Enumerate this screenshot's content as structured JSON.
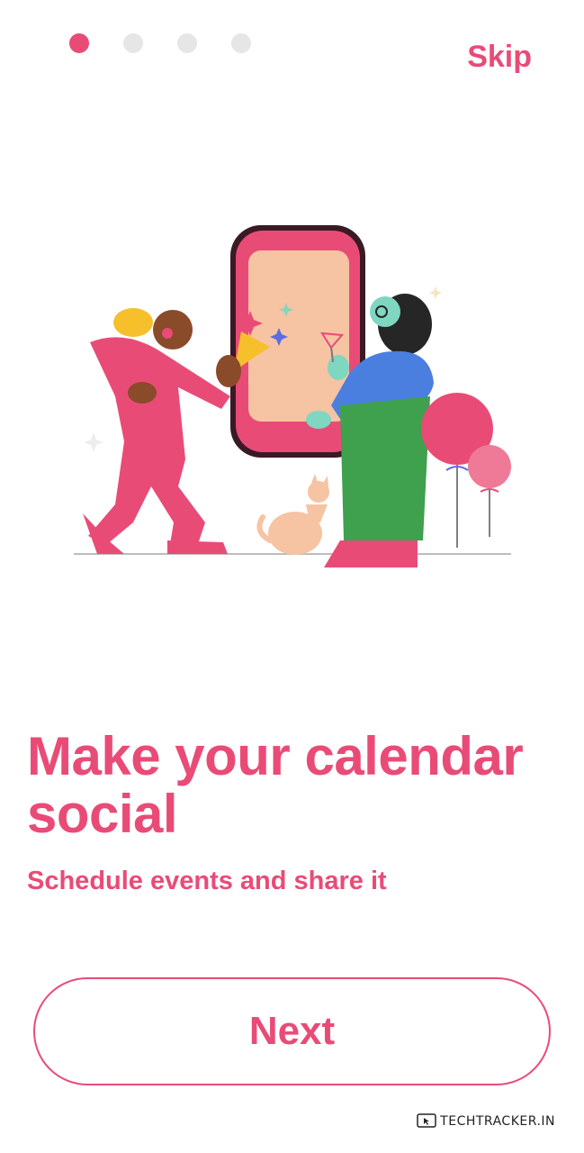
{
  "pager": {
    "total": 4,
    "active_index": 0
  },
  "header": {
    "skip_label": "Skip"
  },
  "main": {
    "title": "Make your calendar social",
    "subtitle": "Schedule events and share it"
  },
  "footer": {
    "next_label": "Next"
  },
  "watermark": {
    "text": "TECHTRACKER.IN"
  },
  "colors": {
    "accent": "#e94b77",
    "dot_inactive": "#e6e6e6",
    "background": "#ffffff"
  },
  "illustration": {
    "icon": "celebration-illustration"
  }
}
